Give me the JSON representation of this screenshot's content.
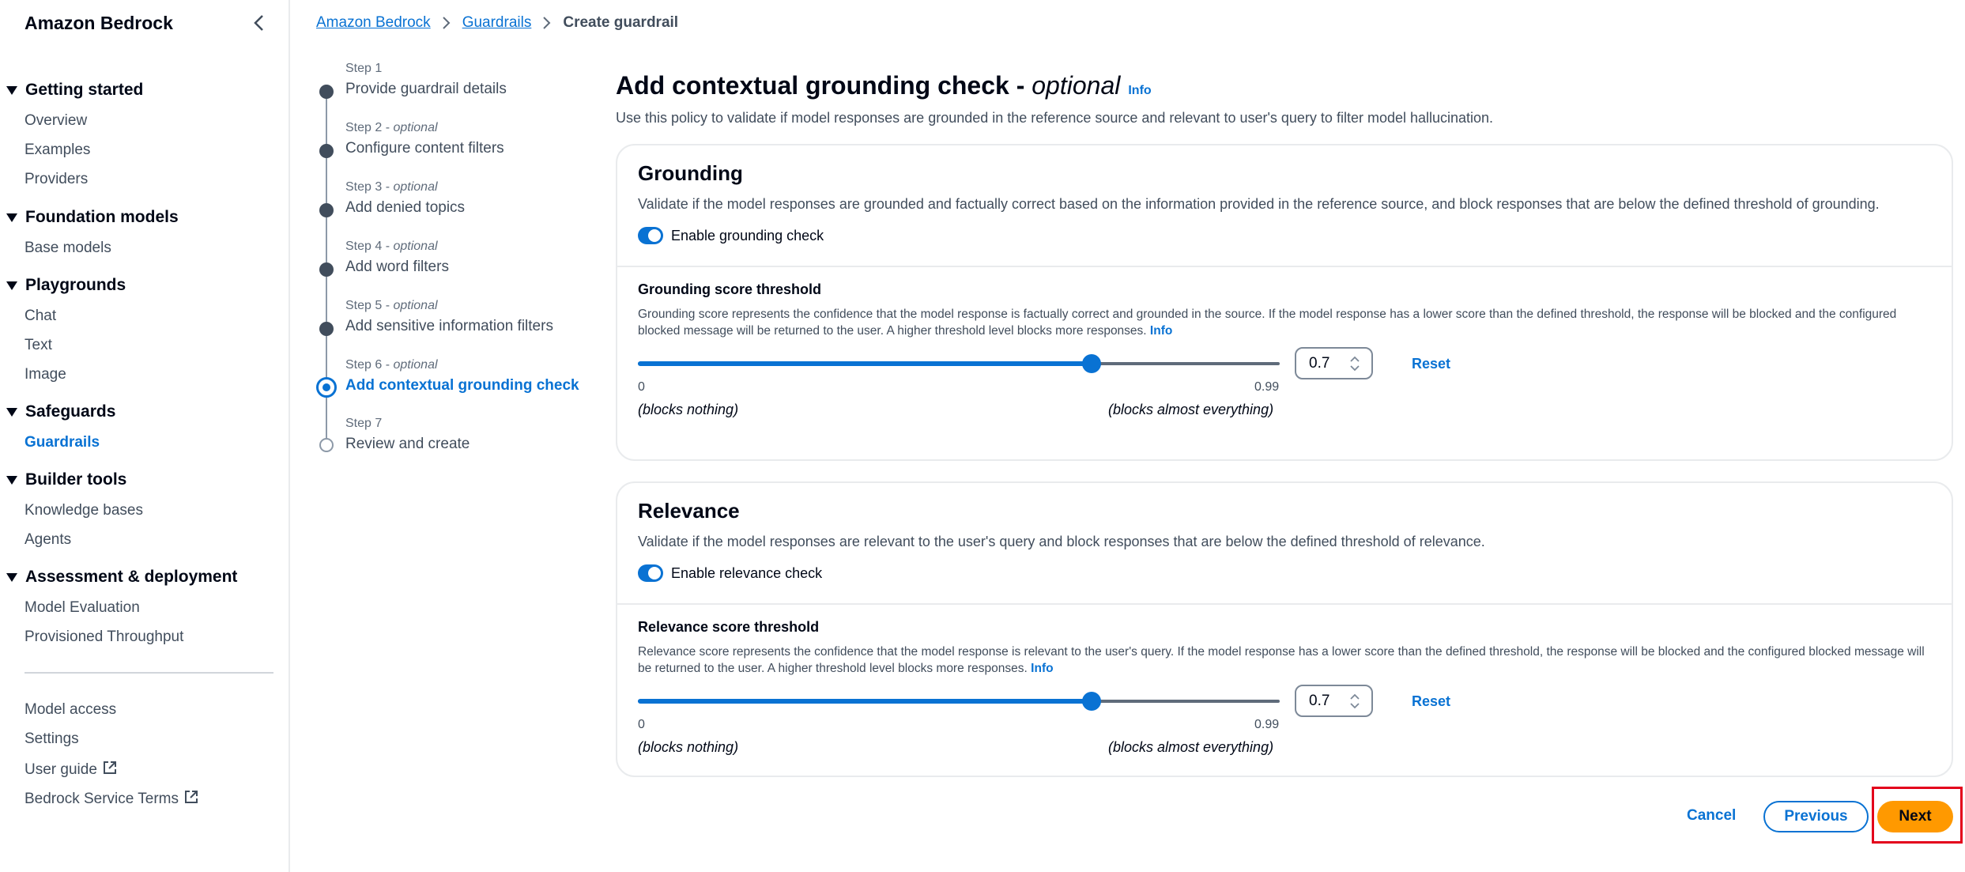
{
  "sidebar": {
    "title": "Amazon Bedrock",
    "sections": [
      {
        "label": "Getting started",
        "items": [
          "Overview",
          "Examples",
          "Providers"
        ]
      },
      {
        "label": "Foundation models",
        "items": [
          "Base models"
        ]
      },
      {
        "label": "Playgrounds",
        "items": [
          "Chat",
          "Text",
          "Image"
        ]
      },
      {
        "label": "Safeguards",
        "items": [
          "Guardrails"
        ]
      },
      {
        "label": "Builder tools",
        "items": [
          "Knowledge bases",
          "Agents"
        ]
      },
      {
        "label": "Assessment & deployment",
        "items": [
          "Model Evaluation",
          "Provisioned Throughput"
        ]
      }
    ],
    "footer_items": [
      "Model access",
      "Settings",
      "User guide",
      "Bedrock Service Terms"
    ],
    "active_item": "Guardrails"
  },
  "breadcrumb": {
    "items": [
      "Amazon Bedrock",
      "Guardrails"
    ],
    "current": "Create guardrail"
  },
  "steps": [
    {
      "num": "Step 1",
      "optional": "",
      "title": "Provide guardrail details"
    },
    {
      "num": "Step 2 - ",
      "optional": "optional",
      "title": "Configure content filters"
    },
    {
      "num": "Step 3 - ",
      "optional": "optional",
      "title": "Add denied topics"
    },
    {
      "num": "Step 4 - ",
      "optional": "optional",
      "title": "Add word filters"
    },
    {
      "num": "Step 5 - ",
      "optional": "optional",
      "title": "Add sensitive information filters"
    },
    {
      "num": "Step 6 - ",
      "optional": "optional",
      "title": "Add contextual grounding check"
    },
    {
      "num": "Step 7",
      "optional": "",
      "title": "Review and create"
    }
  ],
  "page": {
    "title": "Add contextual grounding check - ",
    "title_optional": "optional",
    "info": "Info",
    "description": "Use this policy to validate if model responses are grounded in the reference source and relevant to user's query to filter model hallucination."
  },
  "grounding": {
    "title": "Grounding",
    "description": "Validate if the model responses are grounded and factually correct based on the information provided in the reference source, and block responses that are below the defined threshold of grounding.",
    "toggle_label": "Enable grounding check",
    "toggle_on": true,
    "threshold_label": "Grounding score threshold",
    "threshold_desc": "Grounding score represents the confidence that the model response is factually correct and grounded in the source. If the model response has a lower score than the defined threshold, the response will be blocked and the configured blocked message will be returned to the user. A higher threshold level blocks more responses.",
    "info": "Info",
    "min": "0",
    "max": "0.99",
    "min_note": "(blocks nothing)",
    "max_note": "(blocks almost everything)",
    "value": "0.7",
    "reset": "Reset"
  },
  "relevance": {
    "title": "Relevance",
    "description": "Validate if the model responses are relevant to the user's query and block responses that are below the defined threshold of relevance.",
    "toggle_label": "Enable relevance check",
    "toggle_on": true,
    "threshold_label": "Relevance score threshold",
    "threshold_desc": "Relevance score represents the confidence that the model response is relevant to the user's query. If the model response has a lower score than the defined threshold, the response will be blocked and the configured blocked message will be returned to the user. A higher threshold level blocks more responses.",
    "info": "Info",
    "min": "0",
    "max": "0.99",
    "min_note": "(blocks nothing)",
    "max_note": "(blocks almost everything)",
    "value": "0.7",
    "reset": "Reset"
  },
  "footer": {
    "cancel": "Cancel",
    "previous": "Previous",
    "next": "Next"
  },
  "colors": {
    "accent": "#0972d3",
    "primary_button": "#ff9900",
    "highlight": "#e3001b"
  }
}
